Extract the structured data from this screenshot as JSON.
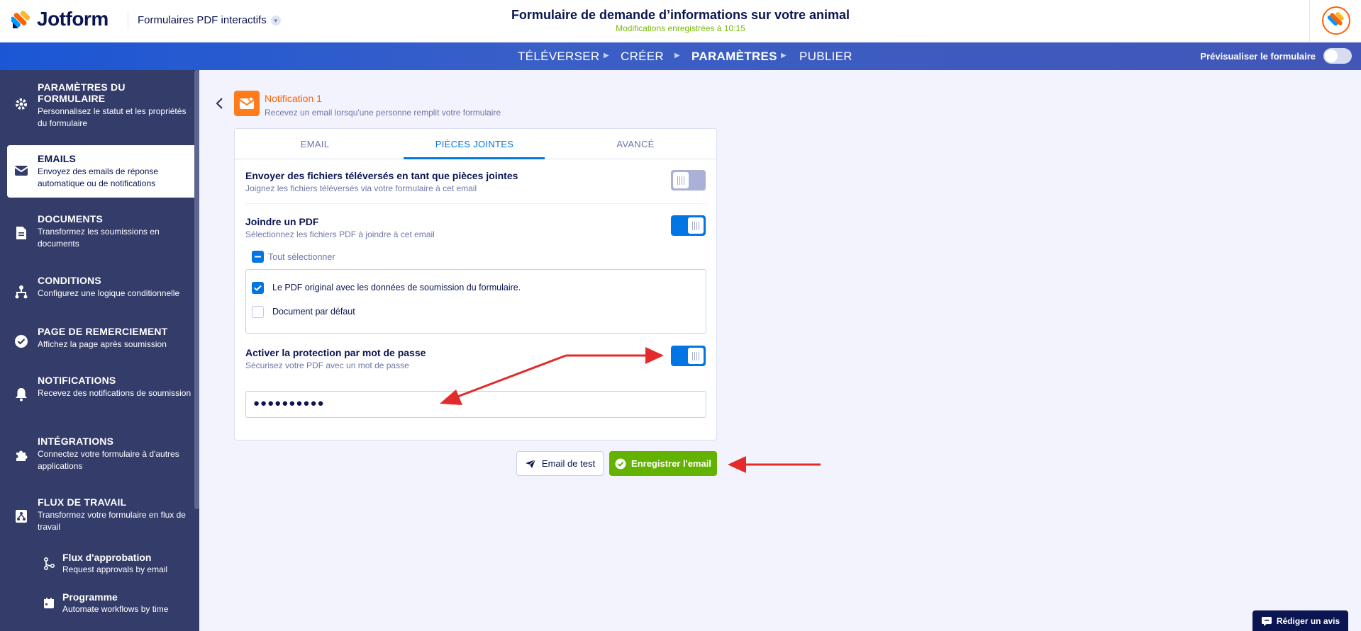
{
  "app": {
    "brand": "Jotform",
    "form_type": "Formulaires PDF interactifs"
  },
  "header": {
    "title": "Formulaire de demande d’informations sur votre animal",
    "saved": "Modifications enregistrées à 10:15"
  },
  "nav": {
    "items": [
      "TÉLÉVERSER",
      "CRÉER",
      "PARAMÈTRES",
      "PUBLIER"
    ],
    "preview_label": "Prévisualiser le formulaire"
  },
  "sidebar": {
    "items": [
      {
        "title": "PARAMÈTRES DU FORMULAIRE",
        "desc": "Personnalisez le statut et les propriétés du formulaire",
        "icon": "gear-icon"
      },
      {
        "title": "EMAILS",
        "desc": "Envoyez des emails de réponse automatique ou de notifications",
        "icon": "envelope-icon"
      },
      {
        "title": "DOCUMENTS",
        "desc": "Transformez les soumissions en documents",
        "icon": "document-icon"
      },
      {
        "title": "CONDITIONS",
        "desc": "Configurez une logique conditionnelle",
        "icon": "flow-icon"
      },
      {
        "title": "PAGE DE REMERCIEMENT",
        "desc": "Affichez la page après soumission",
        "icon": "check-circle-icon"
      },
      {
        "title": "NOTIFICATIONS",
        "desc": "Recevez des notifications de soumission",
        "icon": "bell-icon"
      },
      {
        "title": "INTÉGRATIONS",
        "desc": "Connectez votre formulaire à d'autres applications",
        "icon": "puzzle-icon"
      },
      {
        "title": "FLUX DE TRAVAIL",
        "desc": "Transformez votre formulaire en flux de travail",
        "icon": "workflow-icon"
      }
    ],
    "subitems": [
      {
        "title": "Flux d'approbation",
        "desc": "Request approvals by email",
        "icon": "approval-icon"
      },
      {
        "title": "Programme",
        "desc": "Automate workflows by time",
        "icon": "calendar-icon"
      }
    ],
    "active": "EMAILS"
  },
  "notification": {
    "title": "Notification 1",
    "desc": "Recevez un email lorsqu'une personne remplit votre formulaire"
  },
  "tabs": [
    "EMAIL",
    "PIÈCES JOINTES",
    "AVANCÉ"
  ],
  "active_tab": "PIÈCES JOINTES",
  "settings": {
    "upload_attach": {
      "title": "Envoyer des fichiers téléversés en tant que pièces jointes",
      "desc": "Joignez les fichiers téléversés via votre formulaire à cet email",
      "on": false
    },
    "attach_pdf": {
      "title": "Joindre un PDF",
      "desc": "Sélectionnez les fichiers PDF à joindre à cet email",
      "on": true
    },
    "select_all": "Tout sélectionner",
    "pdf_options": [
      {
        "label": "Le PDF original avec les données de soumission du formulaire.",
        "checked": true
      },
      {
        "label": "Document par défaut",
        "checked": false
      }
    ],
    "password_protect": {
      "title": "Activer la protection par mot de passe",
      "desc": "Sécurisez votre PDF avec un mot de passe",
      "on": true
    },
    "password_value": "●●●●●●●●●●"
  },
  "buttons": {
    "test": "Email de test",
    "save": "Enregistrer l'email",
    "review": "Rédiger un avis"
  },
  "colors": {
    "accent": "#0075e3",
    "brand_orange": "#ff6100",
    "sidebar": "#343c6a",
    "save": "#64b200",
    "annotation": "#e32b2b"
  }
}
